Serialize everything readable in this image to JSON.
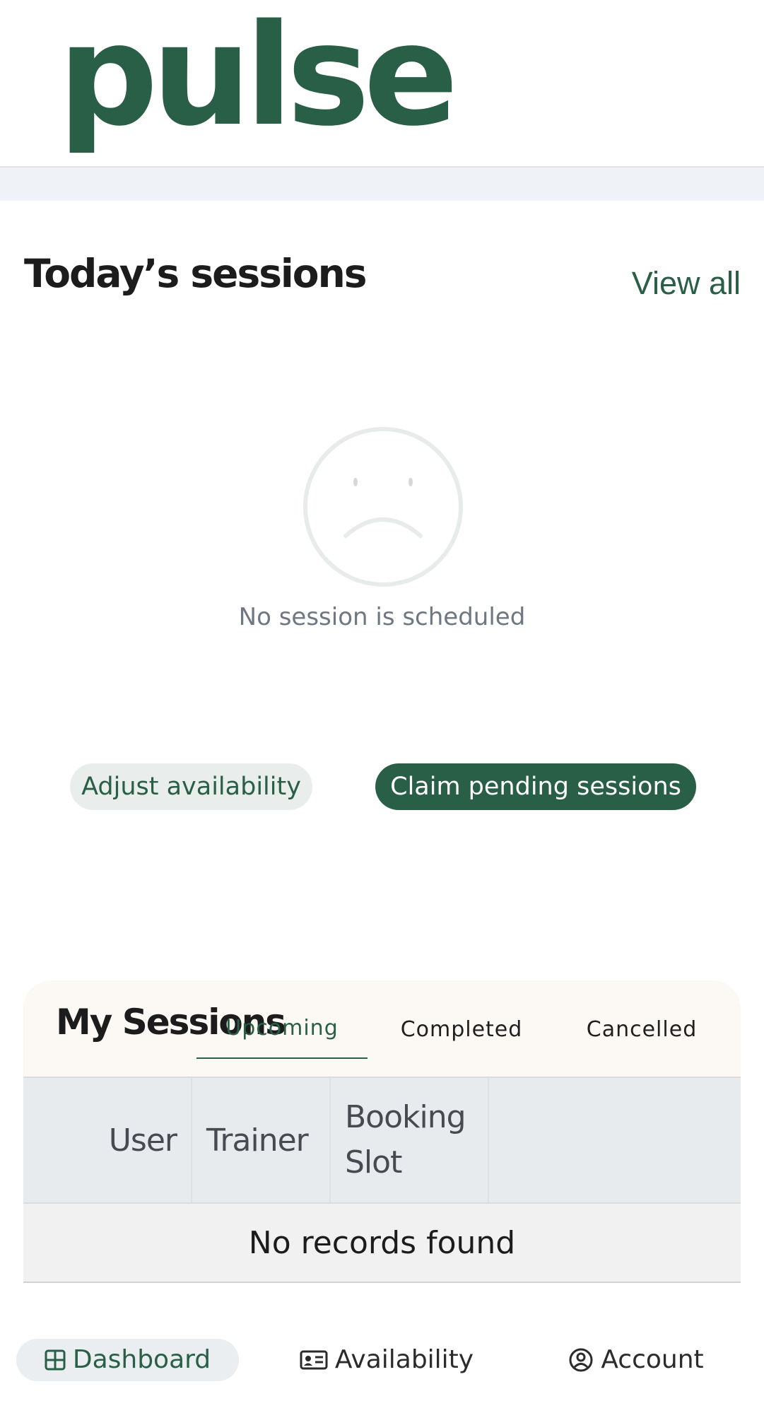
{
  "header": {
    "logo_text": "pulse"
  },
  "today": {
    "title": "Today’s sessions",
    "view_all": "View all",
    "empty_icon": "sad-face-icon",
    "empty_text": "No session is scheduled"
  },
  "actions": {
    "adjust_label": "Adjust availability",
    "claim_label": "Claim pending sessions"
  },
  "my_sessions": {
    "title": "My Sessions",
    "tabs": [
      {
        "label": "Upcoming",
        "active": true
      },
      {
        "label": "Completed",
        "active": false
      },
      {
        "label": "Cancelled",
        "active": false
      }
    ],
    "columns": [
      "User",
      "Trainer",
      "Booking Slot"
    ],
    "empty_text": "No records found"
  },
  "nav": {
    "items": [
      {
        "label": "Dashboard",
        "icon": "grid-icon",
        "active": true
      },
      {
        "label": "Availability",
        "icon": "id-card-icon",
        "active": false
      },
      {
        "label": "Account",
        "icon": "user-circle-icon",
        "active": false
      }
    ]
  },
  "colors": {
    "brand": "#2a5f47",
    "band": "#eff2f6",
    "card_header": "#fcf9f5",
    "table_header": "#e8ebee"
  }
}
